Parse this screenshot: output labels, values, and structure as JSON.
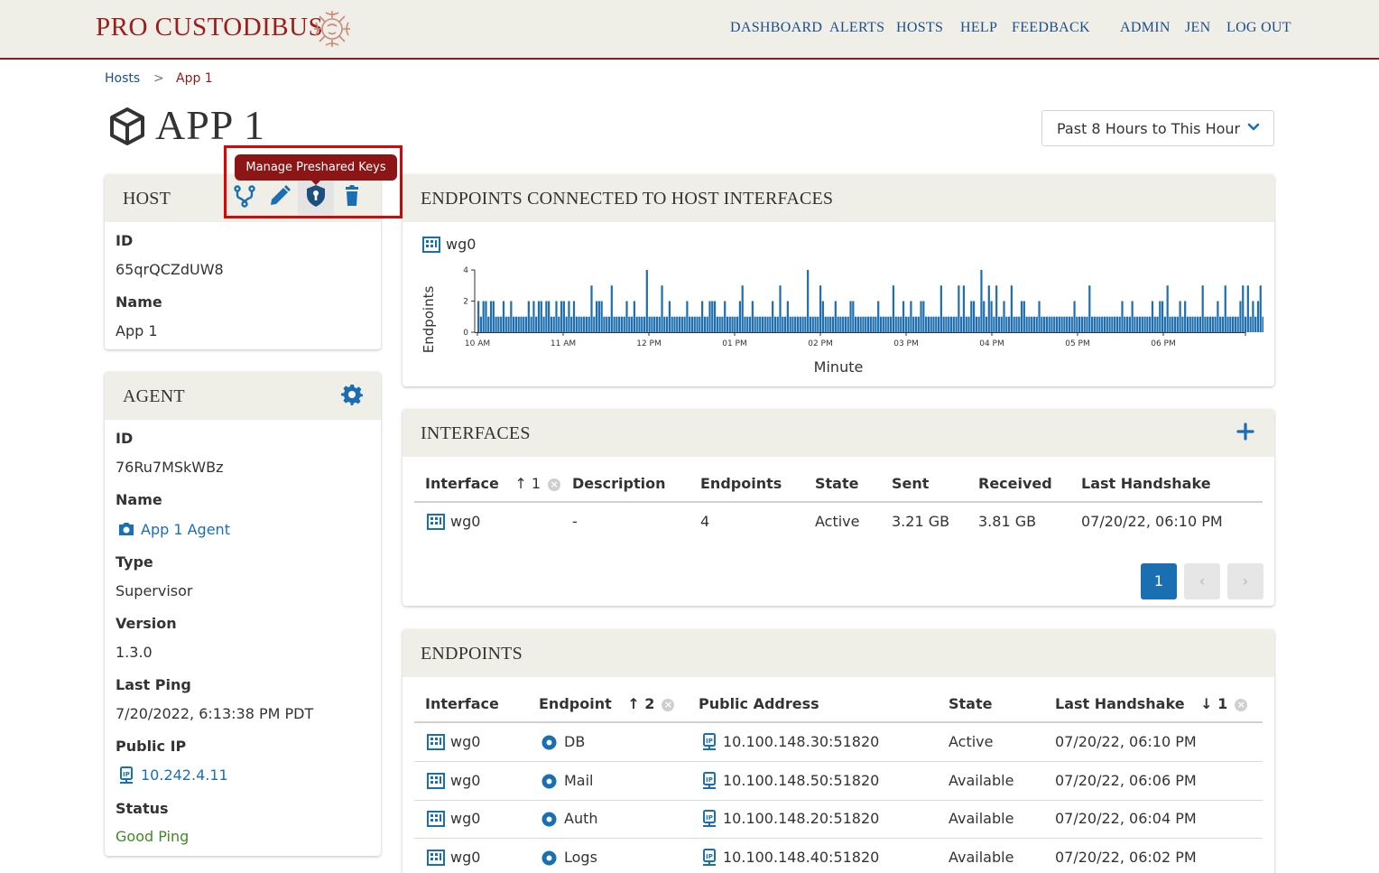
{
  "brand": {
    "name": "PRO CUSTODIBUS"
  },
  "nav": {
    "items": [
      "DASHBOARD",
      "ALERTS",
      "HOSTS",
      "HELP",
      "FEEDBACK"
    ],
    "user_items": [
      "ADMIN",
      "JEN",
      "LOG OUT"
    ]
  },
  "breadcrumb": {
    "parent": "Hosts",
    "separator": ">",
    "current": "App 1"
  },
  "page": {
    "title": "APP 1"
  },
  "range_select": {
    "value": "Past 8 Hours to This Hour"
  },
  "host_panel": {
    "title": "HOST",
    "tooltip": "Manage Preshared Keys",
    "actions": [
      "connections-icon",
      "edit-icon",
      "preshared-key-icon",
      "delete-icon"
    ],
    "id_label": "ID",
    "id_value": "65qrQCZdUW8",
    "name_label": "Name",
    "name_value": "App 1"
  },
  "agent_panel": {
    "title": "AGENT",
    "id_label": "ID",
    "id_value": "76Ru7MSkWBz",
    "name_label": "Name",
    "name_value": "App 1 Agent",
    "type_label": "Type",
    "type_value": "Supervisor",
    "version_label": "Version",
    "version_value": "1.3.0",
    "ping_label": "Last Ping",
    "ping_value": "7/20/2022, 6:13:38 PM PDT",
    "ip_label": "Public IP",
    "ip_value": "10.242.4.11",
    "status_label": "Status",
    "status_value": "Good Ping"
  },
  "endpoints_chart_panel": {
    "title": "ENDPOINTS CONNECTED TO HOST INTERFACES",
    "interface_link": "wg0"
  },
  "chart_data": {
    "type": "bar",
    "xlabel": "Minute",
    "ylabel": "Endpoints",
    "ylim": [
      0,
      4
    ],
    "yticks": [
      0,
      2,
      4
    ],
    "xticks": [
      "10 AM",
      "11 AM",
      "12 PM",
      "01 PM",
      "02 PM",
      "03 PM",
      "04 PM",
      "05 PM",
      "06 PM"
    ],
    "x_start_hour": 10,
    "x_end_hour": 19,
    "values": [
      2,
      1,
      2,
      2,
      1,
      2,
      2,
      1,
      1,
      1,
      2,
      1,
      1,
      2,
      1,
      1,
      1,
      1,
      1,
      1,
      2,
      1,
      2,
      1,
      2,
      2,
      1,
      2,
      2,
      1,
      1,
      2,
      1,
      2,
      2,
      1,
      2,
      1,
      2,
      1,
      1,
      1,
      1,
      1,
      1,
      3,
      1,
      2,
      2,
      2,
      1,
      1,
      1,
      3,
      1,
      1,
      1,
      1,
      1,
      2,
      1,
      1,
      2,
      1,
      1,
      1,
      1,
      4,
      1,
      1,
      1,
      1,
      1,
      3,
      1,
      1,
      2,
      1,
      1,
      1,
      1,
      1,
      1,
      2,
      1,
      1,
      1,
      1,
      1,
      2,
      1,
      1,
      2,
      2,
      2,
      1,
      1,
      1,
      2,
      1,
      1,
      1,
      1,
      1,
      2,
      3,
      1,
      1,
      1,
      2,
      1,
      1,
      1,
      1,
      1,
      1,
      1,
      2,
      1,
      1,
      3,
      1,
      1,
      2,
      1,
      1,
      1,
      1,
      1,
      1,
      1,
      4,
      1,
      1,
      1,
      1,
      3,
      2,
      1,
      1,
      1,
      1,
      2,
      1,
      1,
      1,
      1,
      1,
      2,
      2,
      1,
      1,
      1,
      1,
      1,
      1,
      1,
      1,
      1,
      2,
      1,
      1,
      1,
      1,
      1,
      3,
      1,
      1,
      1,
      2,
      1,
      1,
      2,
      1,
      1,
      1,
      2,
      2,
      1,
      1,
      1,
      1,
      1,
      1,
      3,
      1,
      1,
      1,
      1,
      1,
      1,
      3,
      1,
      3,
      1,
      1,
      2,
      2,
      1,
      1,
      4,
      2,
      1,
      3,
      2,
      1,
      3,
      1,
      1,
      2,
      1,
      1,
      3,
      1,
      1,
      1,
      2,
      2,
      1,
      1,
      1,
      1,
      1,
      2,
      1,
      1,
      1,
      1,
      1,
      1,
      1,
      1,
      1,
      1,
      1,
      1,
      1,
      2,
      1,
      1,
      1,
      1,
      1,
      3,
      1,
      1,
      1,
      1,
      1,
      1,
      1,
      1,
      1,
      1,
      1,
      1,
      2,
      1,
      1,
      1,
      2,
      1,
      1,
      1,
      1,
      1,
      1,
      1,
      2,
      1,
      1,
      2,
      2,
      1,
      3,
      1,
      1,
      1,
      1,
      2,
      1,
      2,
      1,
      1,
      1,
      1,
      1,
      1,
      3,
      1,
      1,
      1,
      1,
      1,
      2,
      1,
      1,
      3,
      1,
      1,
      1,
      1,
      1,
      2,
      3,
      1,
      3,
      1,
      2,
      1,
      2,
      3,
      1,
      1,
      1,
      3,
      1,
      1,
      2,
      3,
      3,
      2,
      1,
      3,
      1,
      1,
      1,
      1,
      1,
      2,
      2,
      1,
      1,
      1,
      2,
      1,
      2,
      2,
      1,
      2,
      1
    ]
  },
  "interfaces_panel": {
    "title": "INTERFACES",
    "columns": [
      "Interface",
      "Description",
      "Endpoints",
      "State",
      "Sent",
      "Received",
      "Last Handshake"
    ],
    "sort_indicator": "↑ 1",
    "rows": [
      {
        "interface": "wg0",
        "description": "-",
        "endpoints": "4",
        "state": "Active",
        "sent": "3.21 GB",
        "received": "3.81 GB",
        "last_handshake": "07/20/22, 06:10 PM"
      }
    ],
    "pagination": {
      "current": "1",
      "prev": "‹",
      "next": "›"
    }
  },
  "endpoints_panel": {
    "title": "ENDPOINTS",
    "columns": [
      "Interface",
      "Endpoint",
      "Public Address",
      "State",
      "Last Handshake"
    ],
    "sort_endpoint": "↑ 2",
    "sort_handshake": "↓ 1",
    "rows": [
      {
        "interface": "wg0",
        "endpoint": "DB",
        "address": "10.100.148.30:51820",
        "state": "Active",
        "last_handshake": "07/20/22, 06:10 PM"
      },
      {
        "interface": "wg0",
        "endpoint": "Mail",
        "address": "10.100.148.50:51820",
        "state": "Available",
        "last_handshake": "07/20/22, 06:06 PM"
      },
      {
        "interface": "wg0",
        "endpoint": "Auth",
        "address": "10.100.148.20:51820",
        "state": "Available",
        "last_handshake": "07/20/22, 06:04 PM"
      },
      {
        "interface": "wg0",
        "endpoint": "Logs",
        "address": "10.100.148.40:51820",
        "state": "Available",
        "last_handshake": "07/20/22, 06:02 PM"
      }
    ]
  },
  "colors": {
    "brand": "#9b1d1d",
    "nav": "#1a4f8b",
    "link": "#1a6fb3",
    "active": "#3f8a28",
    "bar": "#1f6fb0",
    "header_bg": "#efeee7"
  }
}
